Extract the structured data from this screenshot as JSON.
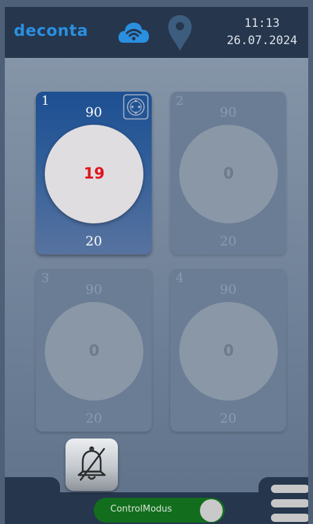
{
  "header": {
    "logo": "deconta",
    "time": "11:13",
    "date": "26.07.2024",
    "icons": [
      "cloud-wifi-icon",
      "location-pin-icon"
    ]
  },
  "channels": [
    {
      "number": "1",
      "upper": "90",
      "value": "19",
      "lower": "20",
      "active": true,
      "icon": "socket-icon"
    },
    {
      "number": "2",
      "upper": "90",
      "value": "0",
      "lower": "20",
      "active": false
    },
    {
      "number": "3",
      "upper": "90",
      "value": "0",
      "lower": "20",
      "active": false
    },
    {
      "number": "4",
      "upper": "90",
      "value": "0",
      "lower": "20",
      "active": false
    }
  ],
  "footer": {
    "mute_icon": "bell-muted-icon",
    "toggle_label": "ControlModus",
    "toggle_on": true,
    "menu_icon": "hamburger-menu-icon"
  },
  "colors": {
    "header_bg": "#25364d",
    "logo": "#2a8fe0",
    "active_value": "#e0141c",
    "toggle_on": "#126e1c"
  }
}
